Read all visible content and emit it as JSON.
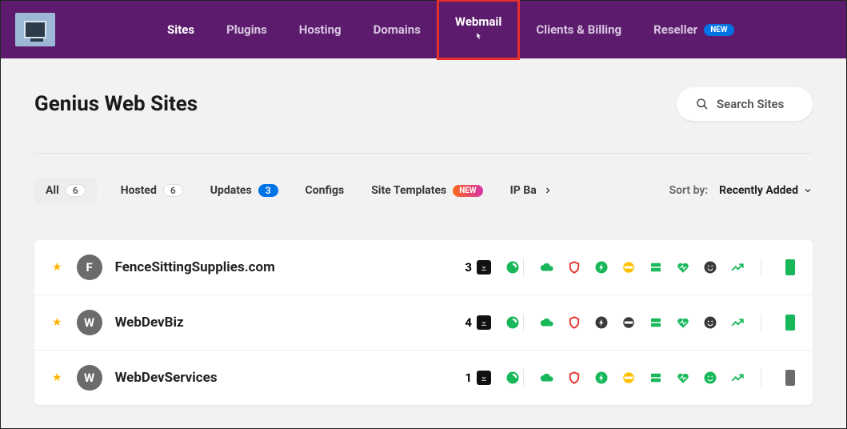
{
  "nav": {
    "items": [
      {
        "label": "Sites",
        "active": true
      },
      {
        "label": "Plugins"
      },
      {
        "label": "Hosting"
      },
      {
        "label": "Domains"
      },
      {
        "label": "Webmail",
        "highlight": true
      },
      {
        "label": "Clients & Billing"
      },
      {
        "label": "Reseller",
        "badge": "NEW"
      }
    ]
  },
  "page": {
    "title": "Genius Web Sites",
    "search_placeholder": "Search Sites"
  },
  "tabs": {
    "all": {
      "label": "All",
      "count": "6"
    },
    "hosted": {
      "label": "Hosted",
      "count": "6"
    },
    "updates": {
      "label": "Updates",
      "count": "3"
    },
    "configs": {
      "label": "Configs"
    },
    "templates": {
      "label": "Site Templates",
      "badge": "NEW"
    },
    "backups": {
      "label": "IP Ba"
    }
  },
  "sort": {
    "label": "Sort by:",
    "value": "Recently Added"
  },
  "sites": [
    {
      "initial": "F",
      "name": "FenceSittingSupplies.com",
      "count": "3",
      "book_color": "#18b85a"
    },
    {
      "initial": "W",
      "name": "WebDevBiz",
      "count": "4",
      "book_color": "#18b85a"
    },
    {
      "initial": "W",
      "name": "WebDevServices",
      "count": "1",
      "book_color": "#6b6b6b"
    }
  ],
  "icons": {
    "row1": [
      "swirl-green",
      "cloud-green",
      "shield-red",
      "bolt-green",
      "coin-yellow",
      "server-green",
      "heart-green",
      "smile-dark",
      "trend-green"
    ],
    "row2": [
      "swirl-green",
      "cloud-green",
      "shield-red",
      "bolt-dark",
      "coin-dark",
      "server-green",
      "heart-green",
      "smile-dark",
      "trend-green"
    ],
    "row3": [
      "swirl-green",
      "cloud-green",
      "shield-red",
      "bolt-green",
      "coin-yellow",
      "server-green",
      "heart-green",
      "smile-green",
      "trend-green"
    ]
  }
}
